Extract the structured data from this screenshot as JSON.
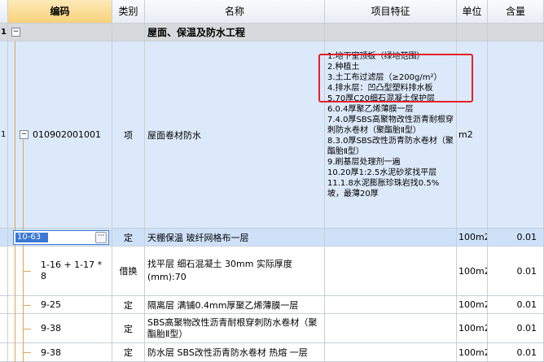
{
  "header": {
    "col_code": "编码",
    "col_type": "类别",
    "col_name": "名称",
    "col_feature": "项目特征",
    "col_unit": "单位",
    "col_qty": "含量"
  },
  "section": {
    "index": "1",
    "toggle": "−",
    "name": "屋面、保温及防水工程"
  },
  "item": {
    "index": "1",
    "toggle": "−",
    "code": "010902001001",
    "type": "项",
    "name": "屋面卷材防水",
    "feature": "1.地下室顶板（绿地范围）\n2.种植土\n3.土工布过滤层（≥200g/m²）\n4.排水层：凹凸型塑料排水板\n5.70厚C20细石混凝土保护层\n6.0.4厚聚乙烯薄膜一层\n7.4.0厚SBS高聚物改性沥青耐根穿刺防水卷材（聚酯胎Ⅱ型）\n8.3.0厚SBS改性沥青防水卷材（聚酯胎Ⅱ型）\n9.刷基层处理剂一遍\n10.20厚1:2.5水泥砂浆找平层\n11.1.8水泥膨胀珍珠岩找0.5%坡，最薄20厚",
    "unit": "m2"
  },
  "rows": [
    {
      "code": "10-63",
      "type": "定",
      "name": "天棚保温 玻纤网格布一层",
      "unit": "100m2",
      "qty": "0.01"
    },
    {
      "code": "1-16 + 1-17 * 8",
      "type": "借换",
      "name": "找平层 细石混凝土 30mm  实际厚度(mm):70",
      "unit": "100m2",
      "qty": "0.01"
    },
    {
      "code": "9-25",
      "type": "定",
      "name": "隔离层 满铺0.4mm厚聚乙烯薄膜一层",
      "unit": "100m2",
      "qty": "0.01"
    },
    {
      "code": "9-38",
      "type": "定",
      "name": "SBS高聚物改性沥青耐根穿刺防水卷材（聚酯胎Ⅱ型）",
      "unit": "100m2",
      "qty": "0.01"
    },
    {
      "code": "9-38",
      "type": "定",
      "name": "防水层 SBS改性沥青防水卷材 热熔 一层",
      "unit": "100m2",
      "qty": "0.01"
    }
  ],
  "editor": {
    "ellipsis": "···"
  }
}
